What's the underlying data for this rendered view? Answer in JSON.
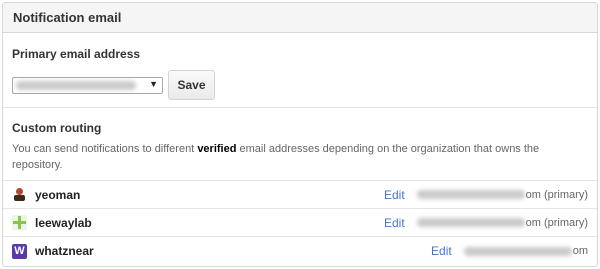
{
  "header": {
    "title": "Notification email"
  },
  "primary": {
    "label": "Primary email address",
    "selected_email_blurred": "rak@revathakumar.com",
    "dropdown_arrow": "▼",
    "save_label": "Save"
  },
  "routing": {
    "title": "Custom routing",
    "desc_before": "You can send notifications to different ",
    "desc_bold": "verified",
    "desc_after": " email addresses depending on the organization that owns the repository."
  },
  "orgs": [
    {
      "name": "yeoman",
      "avatar": "yeoman-avatar",
      "edit_label": "Edit",
      "email_suffix": "om (primary)"
    },
    {
      "name": "leewaylab",
      "avatar": "leewaylab-avatar",
      "edit_label": "Edit",
      "email_suffix": "om (primary)"
    },
    {
      "name": "whatznear",
      "avatar": "whatznear-avatar",
      "avatar_letter": "W",
      "edit_label": "Edit",
      "email_suffix": "om"
    }
  ],
  "colors": {
    "link": "#4078c0",
    "header_bg": "#f5f5f5",
    "border": "#d8d8d8"
  }
}
